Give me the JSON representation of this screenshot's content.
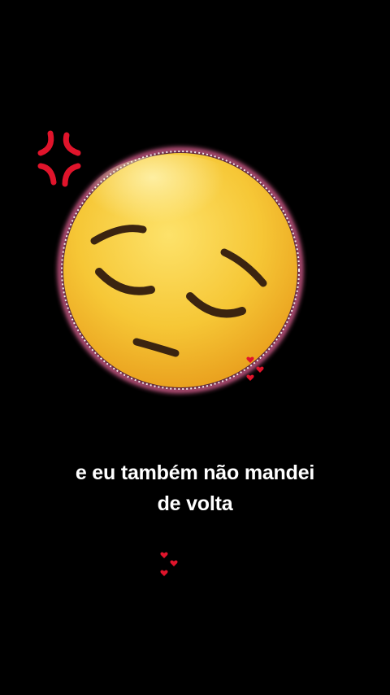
{
  "caption": {
    "line1": "e eu também não mandei",
    "line2": "de volta"
  },
  "scene": {
    "background_color": "#000000",
    "emoji_name": "pensive-face",
    "accent_color": "#e0142b",
    "face_color": "#f7c93a",
    "glow_color": "#ff6fa8"
  }
}
